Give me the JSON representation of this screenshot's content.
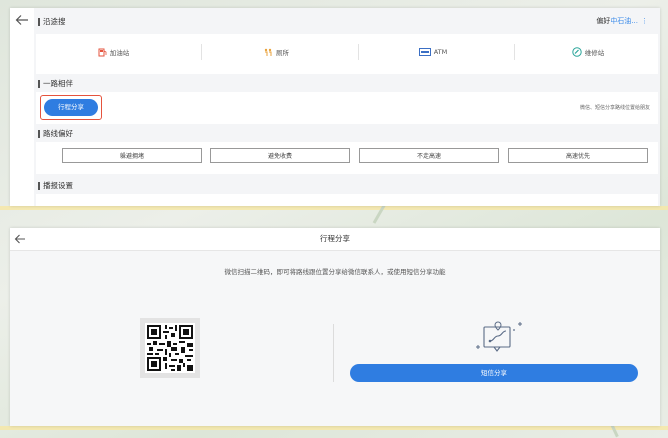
{
  "settings_panel": {
    "along_route_heading": "沿途搜",
    "preference_label": "偏好",
    "preference_value": "中石油...",
    "poi_items": [
      {
        "label": "加油站",
        "icon": "gas-station-icon"
      },
      {
        "label": "厕所",
        "icon": "toilet-icon"
      },
      {
        "label": "ATM",
        "icon": "atm-icon"
      },
      {
        "label": "维修站",
        "icon": "repair-station-icon"
      }
    ],
    "companion_heading": "一路相伴",
    "trip_share_label": "行程分享",
    "trip_share_hint": "微信、短信分享路线位置给朋友",
    "route_pref_heading": "路线偏好",
    "route_options": [
      "躲避拥堵",
      "避免收费",
      "不走高速",
      "高速优先"
    ],
    "broadcast_heading": "播报设置"
  },
  "share_panel": {
    "title": "行程分享",
    "description": "微信扫描二维码，即可将路线跟位置分享给微信联系人，或使用短信分享功能",
    "sms_button_label": "短信分享"
  },
  "colors": {
    "accent": "#2f7de1",
    "highlight": "#e5533d",
    "link": "#3b8bea"
  }
}
